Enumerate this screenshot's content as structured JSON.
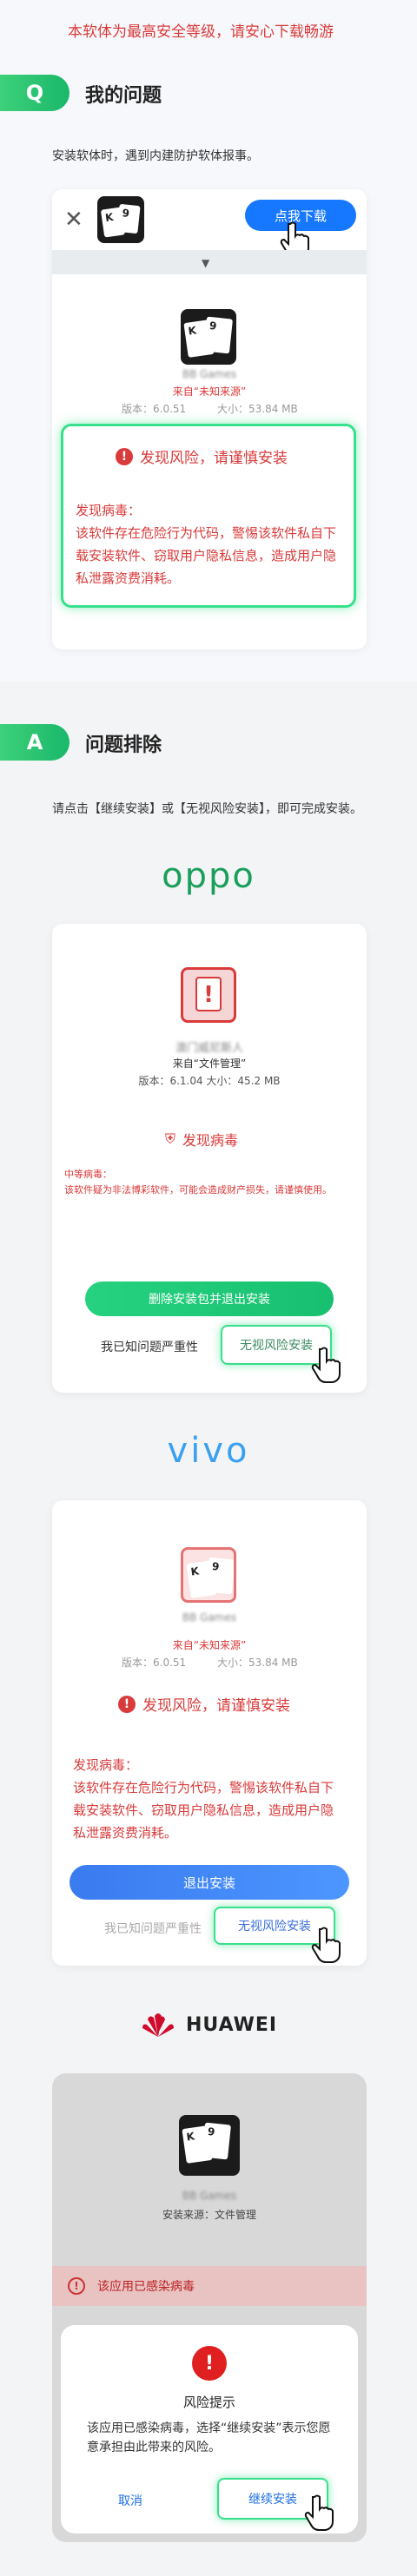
{
  "tagline": "本软体为最高安全等级，请安心下载畅游",
  "q_section": {
    "badge": "Q",
    "title": "我的问题",
    "description": "安装软体时，遇到内建防护软体报事。"
  },
  "download_card": {
    "download_button": "点我下载",
    "source": "来自“未知来源”",
    "version": "版本：6.0.51",
    "size": "大小：53.84 MB",
    "risk_title": "发现风险，请谨慎安装",
    "virus_heading": "发现病毒：",
    "virus_body": "该软件存在危险行为代码，警惕该软件私自下载安装软件、窃取用户隐私信息，造成用户隐私泄露资费消耗。"
  },
  "a_section": {
    "badge": "A",
    "title": "问题排除",
    "description": "请点击【继续安装】或【无视风险安装】，即可完成安装。"
  },
  "oppo": {
    "brand": "oppo",
    "app_name": "澳门威尼斯人",
    "source": "来自“文件管理”",
    "version_size": "版本：6.1.04   大小：45.2 MB",
    "virus_title": "发现病毒",
    "risk_level": "中等病毒：",
    "risk_body": "该软件疑为非法博彩软件，可能会造成财产损失，请谨慎使用。",
    "primary_button": "删除安装包并退出安装",
    "acknowledge_text": "我已知问题严重性",
    "ignore_button": "无视风险安装"
  },
  "vivo": {
    "brand": "vivo",
    "app_name": "BB Games",
    "source": "来自“未知来源”",
    "version": "版本：6.0.51",
    "size": "大小：53.84 MB",
    "risk_title": "发现风险，请谨慎安装",
    "virus_heading": "发现病毒：",
    "virus_body": "该软件存在危险行为代码，警惕该软件私自下载安装软件、窃取用户隐私信息，造成用户隐私泄露资费消耗。",
    "exit_button": "退出安装",
    "acknowledge_text": "我已知问题严重性",
    "ignore_button": "无视风险安装"
  },
  "huawei": {
    "brand": "HUAWEI",
    "app_name": "BB Games",
    "source": "安装来源：文件管理",
    "infected_banner": "该应用已感染病毒",
    "dialog_title": "风险提示",
    "dialog_body": "该应用已感染病毒，选择“继续安装”表示您愿意承担由此带来的风险。",
    "cancel_button": "取消",
    "continue_button": "继续安装"
  },
  "colors": {
    "accent_green": "#37e08a",
    "danger_red": "#d93a3a",
    "blue": "#1677ff",
    "oppo_green": "#1a9f5a",
    "vivo_blue": "#3aa0f0",
    "huawei_red": "#cf0a2c"
  }
}
